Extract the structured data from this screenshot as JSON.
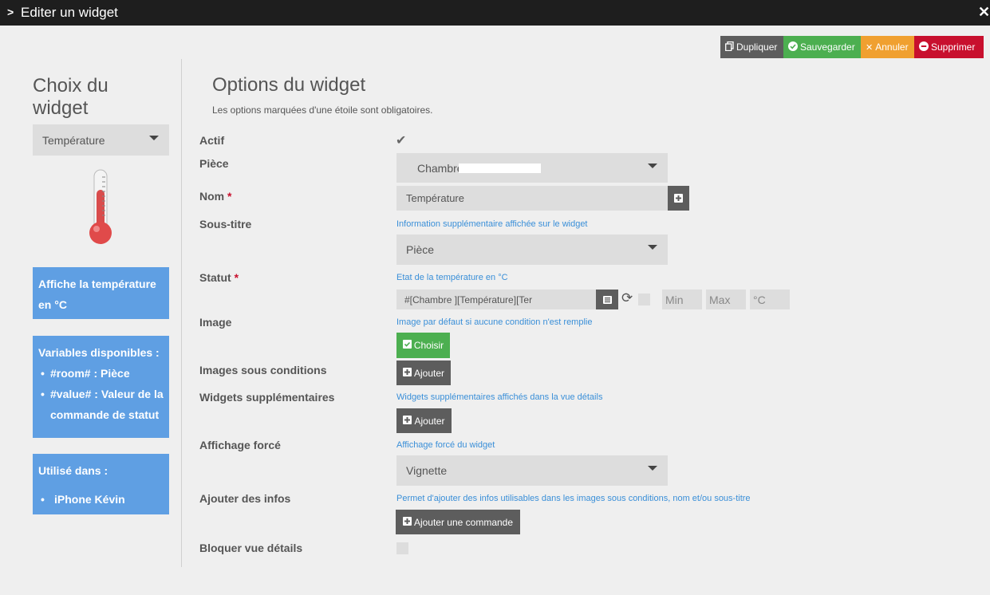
{
  "titlebar": {
    "chevron_icon": "chevron-right-icon",
    "title": "Editer un widget",
    "close_icon": "close-icon",
    "close_glyph": "✕"
  },
  "actions": {
    "duplicate_label": "Dupliquer",
    "save_label": "Sauvegarder",
    "cancel_label": "Annuler",
    "delete_label": "Supprimer"
  },
  "left": {
    "title": "Choix du widget",
    "widget_type": "Température",
    "thermometer_icon": "thermometer-icon",
    "description": "Affiche la température en °C",
    "variables_title": "Variables disponibles :",
    "variables": [
      "#room# : Pièce",
      "#value# : Valeur de la commande de statut"
    ],
    "used_in_title": "Utilisé dans :",
    "used_in": [
      "iPhone Kévin"
    ]
  },
  "main": {
    "title": "Options du widget",
    "subtitle": "Les options marquées d'une étoile sont obligatoires.",
    "actif": {
      "label": "Actif",
      "checked": true
    },
    "piece": {
      "label": "Pièce",
      "value": "Chambre"
    },
    "nom": {
      "label": "Nom",
      "required": "*",
      "value": "Température"
    },
    "sous_titre": {
      "label": "Sous-titre",
      "help": "Information supplémentaire affichée sur le widget",
      "value": "Pièce"
    },
    "statut": {
      "label": "Statut",
      "required": "*",
      "help": "Etat de la température en °C",
      "value": "#[Chambre            ][Température][Ter",
      "min_placeholder": "Min",
      "max_placeholder": "Max",
      "unit_placeholder": "°C"
    },
    "image": {
      "label": "Image",
      "help": "Image par défaut si aucune condition n'est remplie",
      "button": "Choisir"
    },
    "images_cond": {
      "label": "Images sous conditions",
      "button": "Ajouter"
    },
    "widgets_supp": {
      "label": "Widgets supplémentaires",
      "help": "Widgets supplémentaires affichés dans la vue détails",
      "button": "Ajouter"
    },
    "affichage_force": {
      "label": "Affichage forcé",
      "help": "Affichage forcé du widget",
      "value": "Vignette"
    },
    "ajouter_infos": {
      "label": "Ajouter des infos",
      "help": "Permet d'ajouter des infos utilisables dans les images sous conditions, nom et/ou sous-titre",
      "button": "Ajouter une commande"
    },
    "bloquer": {
      "label": "Bloquer vue détails",
      "checked": false
    }
  },
  "colors": {
    "accent_blue": "#5f9fe3",
    "save_green": "#4caf50",
    "cancel_orange": "#f0a030",
    "delete_red": "#c8102e",
    "dark_button": "#5d5d5d"
  }
}
